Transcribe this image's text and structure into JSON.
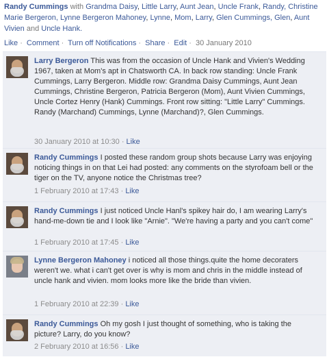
{
  "post": {
    "author": "Randy Cummings",
    "with_word": "with",
    "tags": [
      "Grandma Daisy",
      "Little Larry",
      "Aunt Jean",
      "Uncle Frank",
      "Randy,",
      "Christine Marie Bergeron,",
      "Lynne Bergeron Mahoney",
      "Lynne",
      "Mom",
      "Larry",
      "Glen",
      "Cummings,",
      "Glen",
      "Aunt Vivien",
      "and",
      "Uncle Hank."
    ],
    "actions": [
      "Like",
      "Comment",
      "Turn off Notifications",
      "Share",
      "Edit"
    ],
    "date": "30 January 2010"
  },
  "comments": [
    {
      "author": "Larry Bergeron",
      "text": "This was from the occasion of Uncle Hank and Vivien's Wedding 1967, taken at Mom's apt in Chatsworth CA. In back row standing: Uncle Frank Cummings, Larry Bergeron. Middle row: Grandma Daisy Cummings, Aunt Jean Cummings, Christine Bergeron, Patricia Bergeron (Mom), Aunt Vivien Cummings, Uncle Cortez Henry (Hank) Cummings. Front row sitting: \"Little Larry\" Cummings. Randy (Marchand) Cummings, Lynne (Marchand)?, Glen Cummings.",
      "timestamp": "30 January 2010 at 10:30",
      "like": "Like"
    },
    {
      "author": "Randy Cummings",
      "text": "I posted these random group shots because Larry was enjoying noticing things in on that Lei had posted: any comments on the styrofoam bell or the tiger on the TV, anyone notice the Christmas tree?",
      "timestamp": "1 February 2010 at 17:43",
      "like": "Like"
    },
    {
      "author": "Randy Cummings",
      "text": "I just noticed Uncle Hanl's spikey hair do, I am wearing Larry's hand-me-down tie and I look like \"Arnie\". \"We're having a party and you can't come\"",
      "timestamp": "1 February 2010 at 17:45",
      "like": "Like"
    },
    {
      "author": "Lynne Bergeron Mahoney",
      "text": "i noticed all those things.quite the home decoraters weren't we. what i can't get over is why is mom and chris in the middle instead of uncle hank and vivien. mom looks more like the bride than vivien.",
      "timestamp": "1 February 2010 at 22:39",
      "like": "Like"
    },
    {
      "author": "Randy Cummings",
      "text": "Oh my gosh I just thought of something, who is taking the picture? Larry, do you know?",
      "timestamp": "2 February 2010 at 16:56",
      "like": "Like"
    }
  ]
}
